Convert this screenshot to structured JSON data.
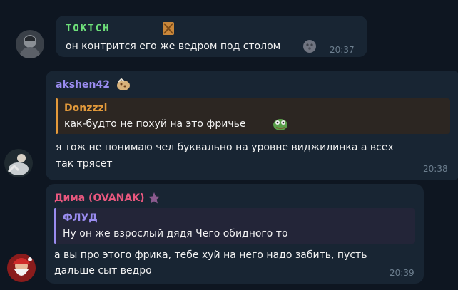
{
  "colors": {
    "background": "#0e1621",
    "bubble": "#182533",
    "time": "#6d7f8f",
    "user1_name": "#6ee07a",
    "user2_name": "#9a8cf0",
    "user3_name": "#e8577e",
    "reply1_accent": "#e39a3b",
    "reply2_accent": "#9a8cf0"
  },
  "messages": [
    {
      "sender": "ТОКТСН",
      "sender_badge_icon": "box-emoji-icon",
      "text_line1": "он контрится его же ведром под столом",
      "emoji": "moon-emoji-icon",
      "time": "20:37"
    },
    {
      "sender": "akshen42",
      "sender_badge_icon": "cookie-emoji-icon",
      "reply_name": "Donzzzi",
      "reply_text": "как-будто не похуй на это фричье",
      "reply_emoji": "pepe-emoji-icon",
      "text_line1": "я тож не понимаю чел буквально на уровне виджилинка а всех",
      "text_line2": "так трясет",
      "time": "20:38"
    },
    {
      "sender": "Дима (OVANAK)",
      "sender_badge_icon": "star-icon",
      "reply_name": "ФЛУД",
      "reply_text": "Ну он же взрослый дядя Чего обидного то",
      "text_line1": "а вы про этого фрика, тебе хуй на него надо забить, пусть",
      "text_line2": "дальше сыт ведро",
      "time": "20:39"
    }
  ]
}
